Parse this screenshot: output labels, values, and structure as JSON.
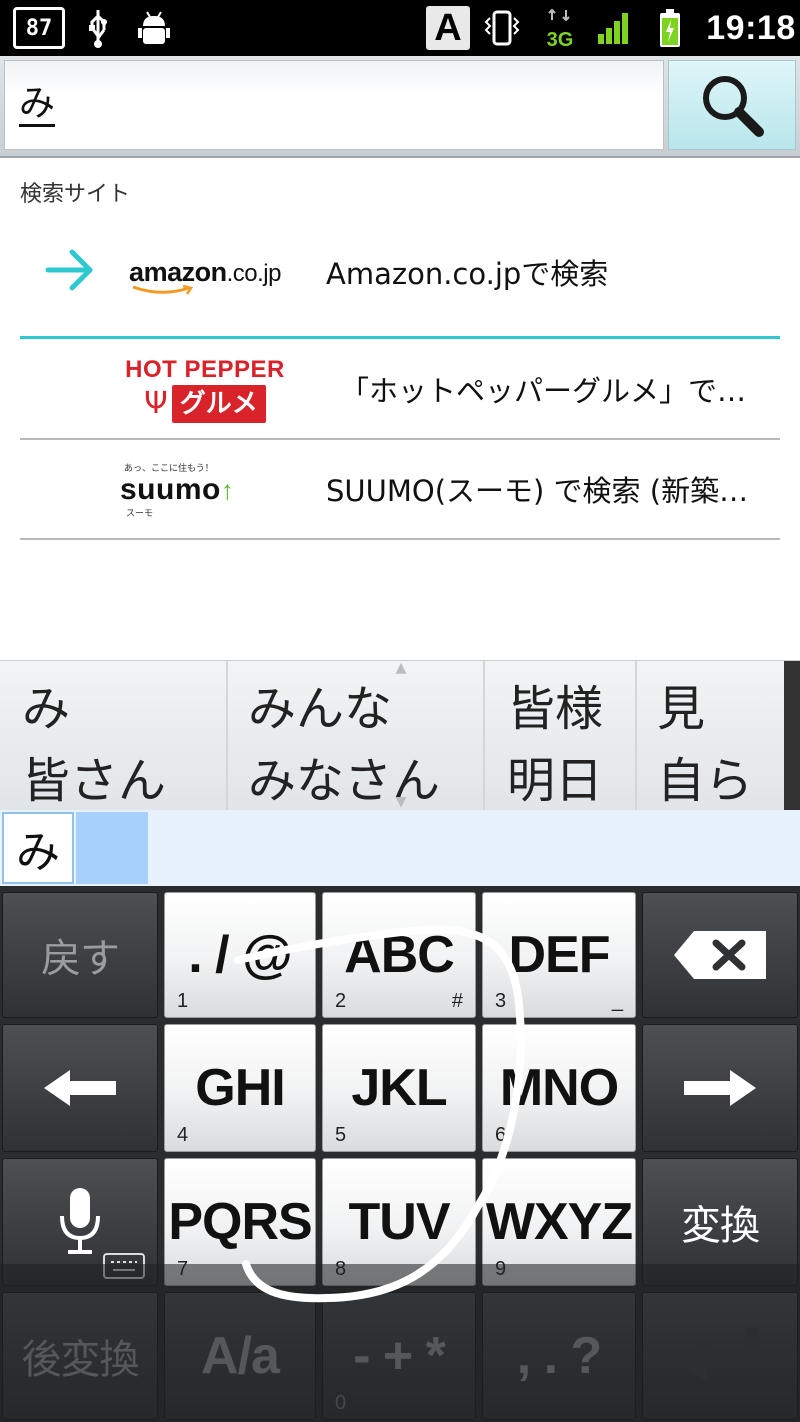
{
  "status_bar": {
    "badge": "87",
    "time": "19:18",
    "input_mode": "A",
    "network": "3G",
    "icons": [
      "notification-badge-icon",
      "usb-icon",
      "android-debug-icon",
      "input-mode-icon",
      "vibrate-icon",
      "network-3g-icon",
      "signal-icon",
      "battery-icon"
    ],
    "signal_level": 1.0,
    "battery_level": 0.85
  },
  "search": {
    "value": "み",
    "button_icon": "magnifier-icon"
  },
  "suggestions": {
    "section_label": "検索サイト",
    "items": [
      {
        "logo_text": "amazon",
        "logo_tld": ".co.jp",
        "label": "Amazon.co.jpで検索",
        "selected": true
      },
      {
        "logo_top": "HOT PEPPER",
        "logo_bottom": "グルメ",
        "label": "「ホットペッパーグルメ」で…"
      },
      {
        "logo_tagline": "あっ、ここに住もう！",
        "logo_text": "suumo",
        "logo_sub": "スーモ",
        "label": "SUUMO(スーモ) で検索 (新築…"
      }
    ]
  },
  "candidates": [
    {
      "top": "み",
      "bottom": "皆さん"
    },
    {
      "top": "みんな",
      "bottom": "みなさん"
    },
    {
      "top": "皆様",
      "bottom": "明日"
    },
    {
      "top": "見",
      "bottom": "自ら"
    }
  ],
  "composing": {
    "text": "み"
  },
  "keyboard": {
    "rows": [
      [
        {
          "label": "戻す",
          "style": "dark",
          "faded": true
        },
        {
          "label": ". / @",
          "num": "1",
          "sub": ""
        },
        {
          "label": "ABC",
          "num": "2",
          "sub": "#"
        },
        {
          "label": "DEF",
          "num": "3",
          "sub": "_"
        },
        {
          "icon": "backspace-icon",
          "style": "dark"
        }
      ],
      [
        {
          "icon": "arrow-left-icon",
          "style": "dark"
        },
        {
          "label": "GHI",
          "num": "4",
          "sub": ""
        },
        {
          "label": "JKL",
          "num": "5",
          "sub": ""
        },
        {
          "label": "MNO",
          "num": "6",
          "sub": ""
        },
        {
          "icon": "arrow-right-icon",
          "style": "dark"
        }
      ],
      [
        {
          "icon": "microphone-icon",
          "style": "dark"
        },
        {
          "label": "PQRS",
          "num": "7",
          "sub": ""
        },
        {
          "label": "TUV",
          "num": "8",
          "sub": ""
        },
        {
          "label": "WXYZ",
          "num": "9",
          "sub": ""
        },
        {
          "label": "変換",
          "style": "dark"
        }
      ],
      [
        {
          "label": "後変換",
          "style": "dark",
          "faded": true
        },
        {
          "label": "A/a",
          "style": "dark",
          "faded": true
        },
        {
          "label": "- + *",
          "num": "0",
          "style": "dark",
          "faded": true
        },
        {
          "label": ", . ?",
          "style": "dark",
          "faded": true
        },
        {
          "icon": "enter-icon",
          "style": "dark"
        }
      ]
    ]
  },
  "colors": {
    "accent": "#2ec8cf",
    "hotpepper_red": "#d8232a",
    "suumo_green": "#5db52e",
    "amazon_orange": "#f29a1f",
    "compose_highlight": "#a7d1fb"
  }
}
